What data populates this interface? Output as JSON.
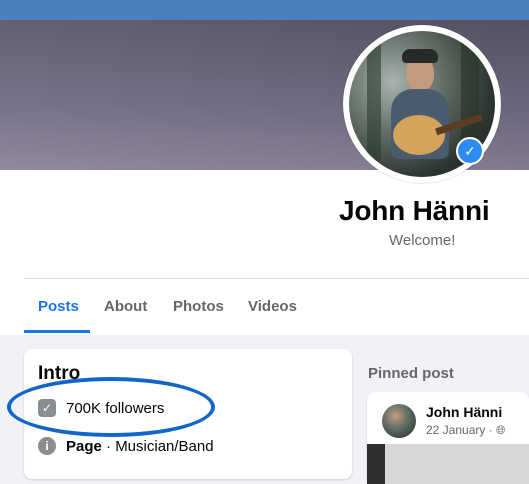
{
  "profile": {
    "name": "John Hänni",
    "welcome": "Welcome!"
  },
  "tabs": [
    "Posts",
    "About",
    "Photos",
    "Videos"
  ],
  "intro": {
    "title": "Intro",
    "followers": "700K followers",
    "page_label": "Page",
    "category": " · Musician/Band"
  },
  "pinned": {
    "label": "Pinned post",
    "author": "John Hänni",
    "date": "22 January · "
  },
  "icons": {
    "verified": "verified-check-icon",
    "followers": "followers-icon",
    "info": "info-icon",
    "globe": "globe-icon"
  },
  "colors": {
    "accent": "#1b74e4",
    "highlight": "#1266c9",
    "cover": "#6f6a82"
  }
}
